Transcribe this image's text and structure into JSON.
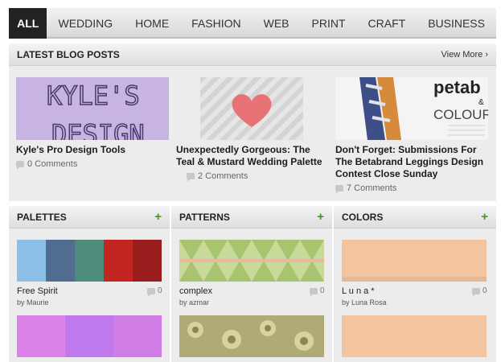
{
  "nav": {
    "items": [
      "ALL",
      "WEDDING",
      "HOME",
      "FASHION",
      "WEB",
      "PRINT",
      "CRAFT",
      "BUSINESS"
    ],
    "active": "ALL"
  },
  "blog": {
    "title": "LATEST BLOG POSTS",
    "view_more": "View More ›",
    "posts": [
      {
        "title": "Kyle's Pro Design Tools",
        "comments": "0 Comments",
        "thumb_text_1": "KYLE'S",
        "thumb_text_2": "DESIGN"
      },
      {
        "title": "Unexpectedly Gorgeous: The Teal & Mustard Wedding Palette",
        "comments": "2 Comments"
      },
      {
        "title": "Don't Forget: Submissions For The Betabrand Leggings Design Contest Close Sunday",
        "comments": "7 Comments",
        "thumb_text_1": "petab",
        "thumb_text_2": "&",
        "thumb_text_3": "COLOUR"
      }
    ]
  },
  "palettes": {
    "title": "PALETTES",
    "plus": "+",
    "cards": [
      {
        "name": "Free Spirit",
        "by": "by Maurie",
        "count": "0",
        "colors": [
          "#8cc0e8",
          "#506c8e",
          "#4e8c7c",
          "#c32520",
          "#9a1e1d"
        ]
      },
      {
        "colors": [
          "#dc82e8",
          "#c07af0",
          "#d07ee6"
        ]
      }
    ]
  },
  "patterns": {
    "title": "PATTERNS",
    "plus": "+",
    "cards": [
      {
        "name": "complex",
        "by": "by azmar",
        "count": "0"
      },
      {}
    ]
  },
  "colors": {
    "title": "COLORS",
    "plus": "+",
    "cards": [
      {
        "name": "L u n a *",
        "by": "by Luna Rosa",
        "count": "0",
        "color": "#f3c4a0"
      },
      {
        "color": "#f3c4a0"
      }
    ]
  }
}
